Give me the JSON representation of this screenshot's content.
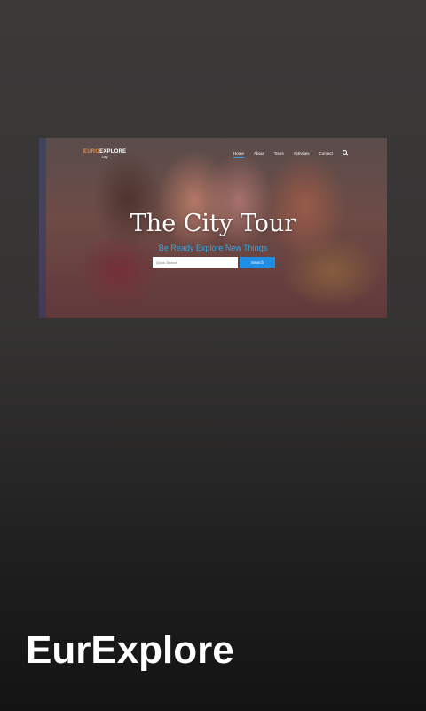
{
  "app": {
    "title": "EurExplore"
  },
  "preview": {
    "logo": {
      "accent": "EURO",
      "main": "EXPLORE",
      "sub": "City"
    },
    "nav": {
      "items": [
        {
          "label": "Home",
          "active": true
        },
        {
          "label": "About",
          "active": false
        },
        {
          "label": "Tours",
          "active": false
        },
        {
          "label": "Activities",
          "active": false
        },
        {
          "label": "Contact",
          "active": false
        }
      ],
      "search_icon": "search-icon"
    },
    "hero": {
      "title": "The City Tour",
      "subtitle": "Be Ready Explore New Things"
    },
    "search": {
      "placeholder": "Quick Search",
      "button_label": "Search"
    }
  },
  "colors": {
    "accent_orange": "#f08a3c",
    "accent_blue": "#1f8fe5",
    "subtitle_blue": "#2fa8e6",
    "background_top": "#3c3a39",
    "background_bottom": "#131313"
  }
}
